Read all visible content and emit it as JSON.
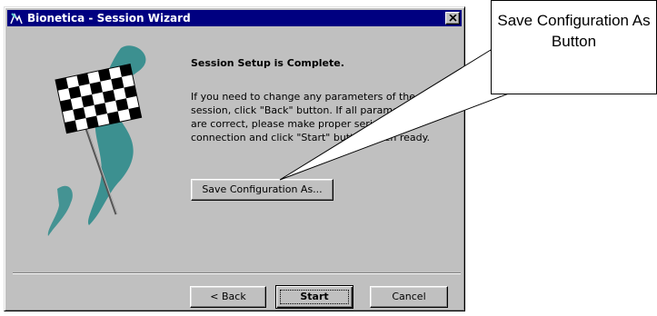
{
  "window": {
    "title": "Bionetica - Session Wizard",
    "heading": "Session Setup is Complete.",
    "body": "If you need to change any parameters of the session, click \"Back\" button. If all parameters are correct, please make proper serial connection and  click \"Start\" button when ready."
  },
  "buttons": {
    "save_config": "Save Configuration As...",
    "back": "< Back",
    "start": "Start",
    "cancel": "Cancel"
  },
  "callout": {
    "text": "Save Configuration As Button"
  },
  "colors": {
    "titlebar": "#000080",
    "face": "#c0c0c0",
    "flag_swoosh": "#2e8b8b"
  },
  "icons": {
    "app": "bionetica-app-icon",
    "close": "close-icon",
    "graphic": "checkered-flag-graphic"
  }
}
